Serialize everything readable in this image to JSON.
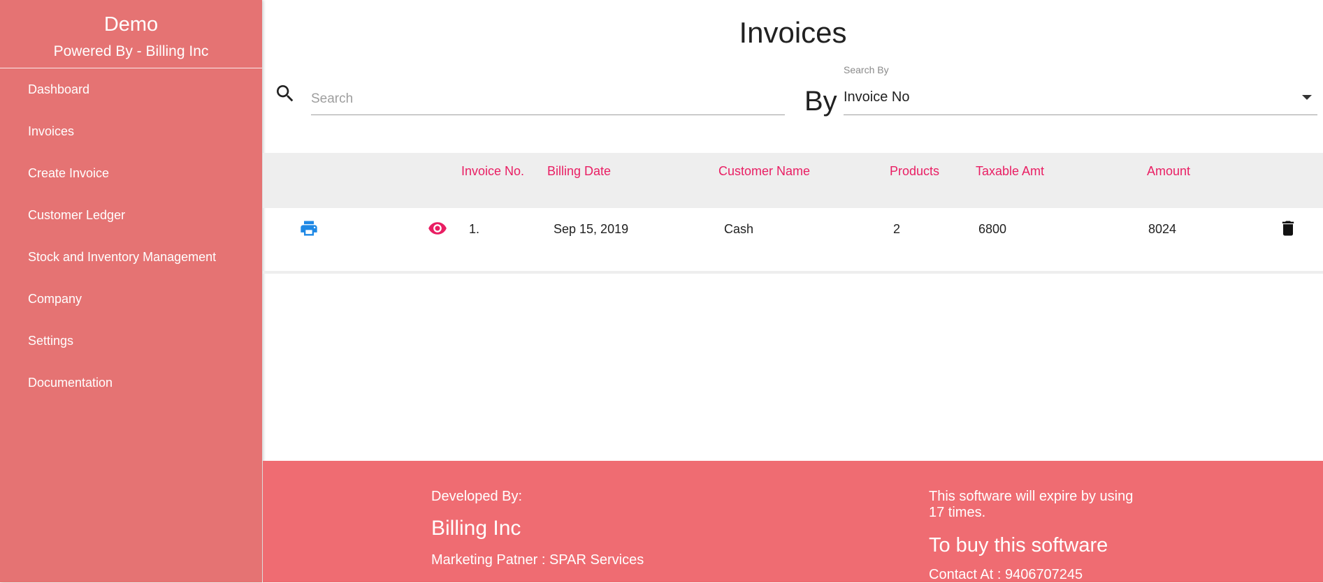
{
  "sidebar": {
    "title": "Demo",
    "subtitle": "Powered By - Billing Inc",
    "items": [
      {
        "label": "Dashboard"
      },
      {
        "label": "Invoices"
      },
      {
        "label": "Create Invoice"
      },
      {
        "label": "Customer Ledger"
      },
      {
        "label": "Stock and Inventory Management"
      },
      {
        "label": "Company"
      },
      {
        "label": "Settings"
      },
      {
        "label": "Documentation"
      }
    ]
  },
  "main": {
    "title": "Invoices",
    "search": {
      "placeholder": "Search",
      "value": ""
    },
    "by_label": "By",
    "search_by": {
      "caption": "Search By",
      "value": "Invoice No"
    },
    "table": {
      "columns": [
        "Invoice No.",
        "Billing Date",
        "Customer Name",
        "Products",
        "Taxable Amt",
        "Amount"
      ],
      "rows": [
        {
          "invoice_no": "1.",
          "billing_date": "Sep 15, 2019",
          "customer_name": "Cash",
          "products": "2",
          "taxable_amt": "6800",
          "amount": "8024"
        }
      ]
    }
  },
  "footer": {
    "developed_by_label": "Developed By:",
    "developer": "Billing Inc",
    "partner": "Marketing Patner : SPAR Services",
    "expiry_line1": "This software will expire by using",
    "expiry_line2": "17 times.",
    "buy": "To buy this software",
    "contact": "Contact At : 9406707245"
  },
  "colors": {
    "sidebar_bg": "#e57373",
    "footer_bg": "#ef6c72",
    "header_text": "#e91e63",
    "print_icon": "#1e88e5",
    "view_icon": "#e91e63",
    "delete_icon": "#111111"
  },
  "icons": [
    "search-icon",
    "print-icon",
    "eye-icon",
    "delete-icon",
    "dropdown-arrow-icon"
  ]
}
